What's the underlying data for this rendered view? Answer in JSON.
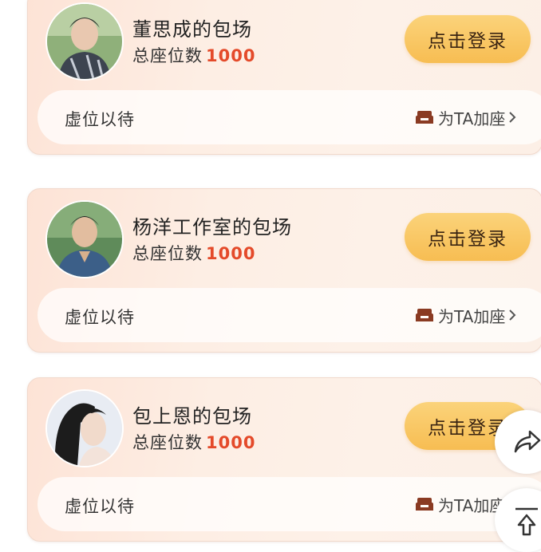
{
  "cards": [
    {
      "host_name": "董思成的包场",
      "seat_label": "总座位数",
      "seat_count": "1000",
      "login_button": "点击登录",
      "waiting_text": "虚位以待",
      "add_seat_label": "为TA加座"
    },
    {
      "host_name": "杨洋工作室的包场",
      "seat_label": "总座位数",
      "seat_count": "1000",
      "login_button": "点击登录",
      "waiting_text": "虚位以待",
      "add_seat_label": "为TA加座"
    },
    {
      "host_name": "包上恩的包场",
      "seat_label": "总座位数",
      "seat_count": "1000",
      "login_button": "点击登录",
      "waiting_text": "虚位以待",
      "add_seat_label": "为TA加座"
    }
  ],
  "colors": {
    "seat_count": "#e44a2a",
    "login_button": "#f7bd52",
    "card_background": "#fdeee4",
    "sofa_icon": "#8a3a22"
  },
  "icons": {
    "add_seat": "sofa-icon",
    "chevron": "chevron-right-icon",
    "share": "share-arrow-icon",
    "top": "back-to-top-icon"
  }
}
